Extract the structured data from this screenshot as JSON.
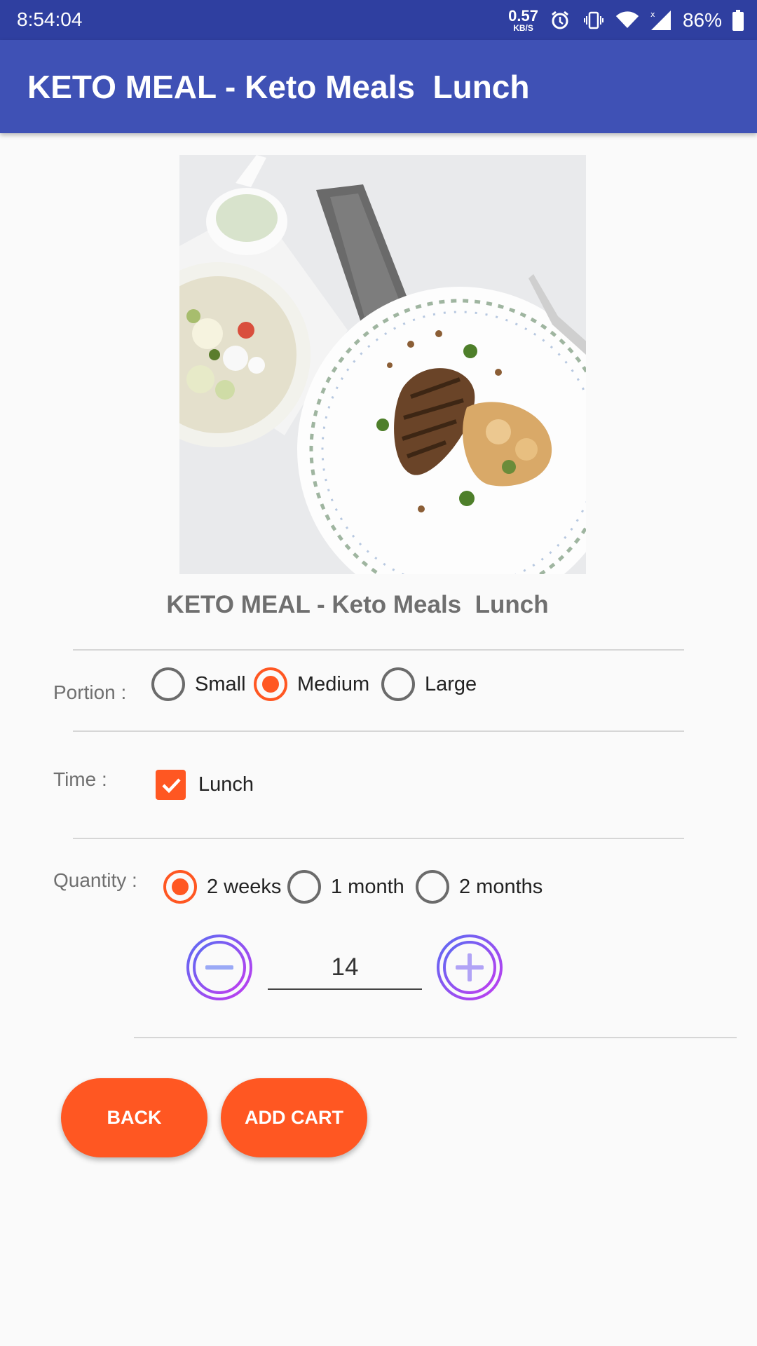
{
  "status_bar": {
    "time": "8:54:04",
    "net_speed": "0.57",
    "net_unit": "KB/S",
    "battery": "86%",
    "icons": [
      "alarm-icon",
      "vibrate-icon",
      "wifi-icon",
      "signal-icon",
      "battery-icon"
    ]
  },
  "app_bar": {
    "title": "KETO MEAL - Keto Meals  Lunch"
  },
  "product": {
    "title": "KETO MEAL - Keto Meals  Lunch"
  },
  "portion": {
    "label": "Portion :",
    "options": [
      "Small",
      "Medium",
      "Large"
    ],
    "selected": "Medium"
  },
  "time": {
    "label": "Time :",
    "option": "Lunch",
    "checked": true
  },
  "quantity": {
    "label": "Quantity :",
    "options": [
      "2 weeks",
      "1 month",
      "2 months"
    ],
    "selected": "2 weeks",
    "value": "14"
  },
  "buttons": {
    "back": "BACK",
    "add_cart": "ADD CART"
  },
  "colors": {
    "primary": "#3f51b5",
    "primary_dark": "#2f3fa0",
    "accent": "#ff5722"
  }
}
